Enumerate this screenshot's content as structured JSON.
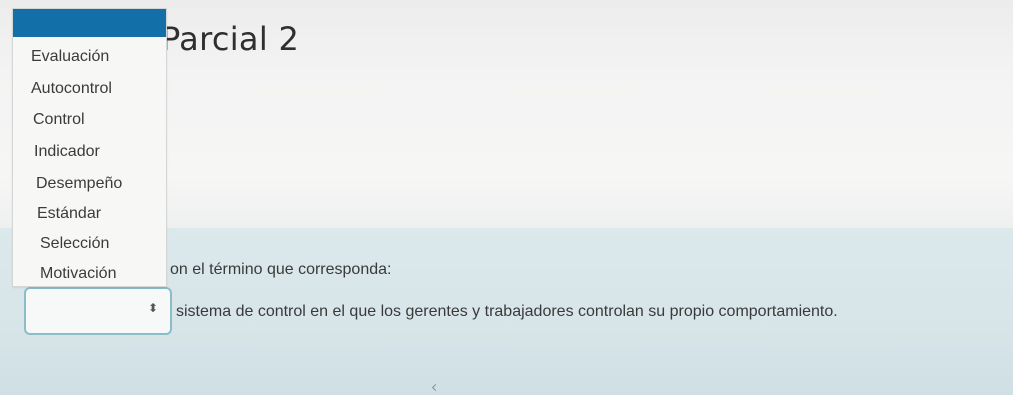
{
  "page": {
    "title": "Parcial 2"
  },
  "question": {
    "prompt": "on el término que corresponda:",
    "statement": "sistema de control en el que los gerentes y trabajadores controlan su propio comportamiento."
  },
  "dropdown": {
    "options": [
      "Evaluación",
      "Autocontrol",
      "Control",
      "Indicador",
      "Desempeño",
      "Estándar",
      "Selección",
      "Motivación"
    ],
    "arrow_icon": "⬍"
  },
  "colors": {
    "header_blue": "#126fa7",
    "panel_blue": "#d7e5e9",
    "select_border": "#8bbcc9"
  },
  "icons": {
    "arrow": "chevron-up-down-icon"
  }
}
